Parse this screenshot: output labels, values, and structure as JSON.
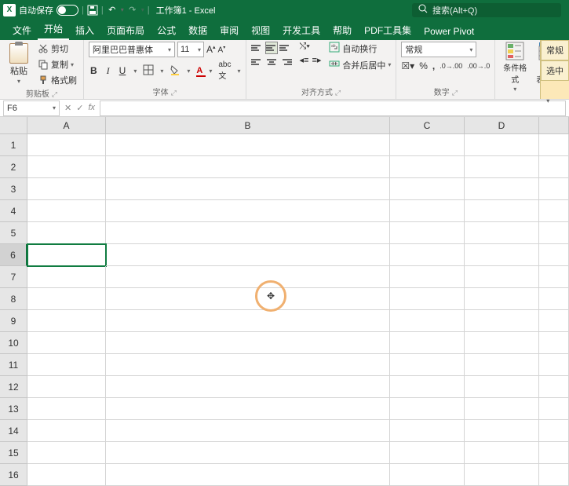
{
  "titlebar": {
    "autosave_label": "自动保存",
    "doc_title": "工作簿1 - Excel",
    "search_placeholder": "搜索(Alt+Q)"
  },
  "tabs": {
    "file": "文件",
    "home": "开始",
    "insert": "插入",
    "layout": "页面布局",
    "formulas": "公式",
    "data": "数据",
    "review": "审阅",
    "view": "视图",
    "dev": "开发工具",
    "help": "帮助",
    "pdf": "PDF工具集",
    "powerpivot": "Power Pivot"
  },
  "ribbon": {
    "clipboard": {
      "paste": "粘贴",
      "cut": "剪切",
      "copy": "复制",
      "painter": "格式刷",
      "label": "剪贴板"
    },
    "font": {
      "name": "阿里巴巴普惠体",
      "size": "11",
      "label": "字体"
    },
    "align": {
      "wrap": "自动换行",
      "merge": "合并后居中",
      "label": "对齐方式"
    },
    "number": {
      "format": "常规",
      "label": "数字"
    },
    "styles": {
      "cond": "条件格式",
      "table": "套用\n表格格式"
    },
    "right": {
      "always": "常规",
      "select": "选中"
    }
  },
  "namebox": {
    "ref": "F6",
    "fx": "fx"
  },
  "columns": [
    "A",
    "B",
    "C",
    "D",
    ""
  ],
  "col_widths": [
    "col-A",
    "col-B",
    "col-C",
    "col-D",
    "col-E"
  ],
  "rows": [
    "1",
    "2",
    "3",
    "4",
    "5",
    "6",
    "7",
    "8",
    "9",
    "10",
    "11",
    "12",
    "13",
    "14",
    "15",
    "16"
  ],
  "selected_row": "6"
}
